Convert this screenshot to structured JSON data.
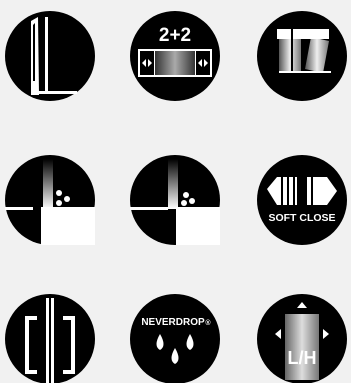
{
  "colors": {
    "background": "#f1f1f1",
    "icon_fill": "#000000",
    "icon_fg": "#ffffff"
  },
  "icons": [
    {
      "name": "slim-profile-icon",
      "label": ""
    },
    {
      "name": "two-plus-two-icon",
      "label": "2+2"
    },
    {
      "name": "glass-panels-icon",
      "label": ""
    },
    {
      "name": "wall-profile-drops-icon",
      "label": ""
    },
    {
      "name": "tray-profile-drops-icon",
      "label": ""
    },
    {
      "name": "soft-close-icon",
      "label": "SOFT CLOSE"
    },
    {
      "name": "bracket-icon",
      "label": ""
    },
    {
      "name": "neverdrop-icon",
      "label": "NEVERDROP",
      "mark": "®"
    },
    {
      "name": "left-right-hand-icon",
      "label": "L/H"
    }
  ]
}
